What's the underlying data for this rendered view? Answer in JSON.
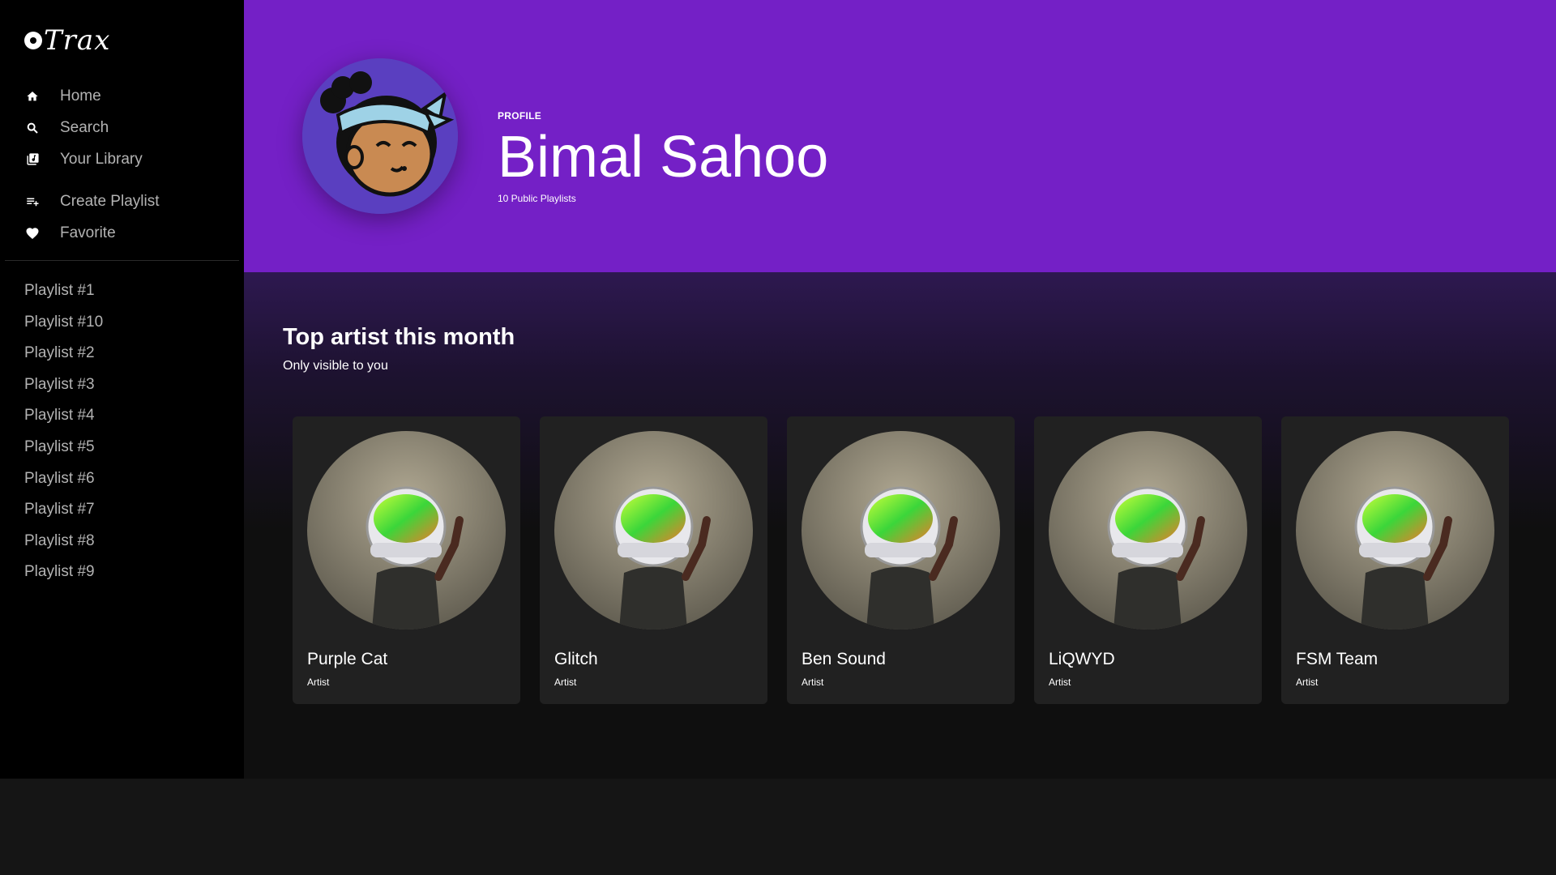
{
  "app": {
    "logo_text": "Trax"
  },
  "nav": {
    "main": [
      {
        "label": "Home",
        "icon": "home-icon"
      },
      {
        "label": "Search",
        "icon": "search-icon"
      },
      {
        "label": "Your Library",
        "icon": "library-icon"
      }
    ],
    "actions": [
      {
        "label": "Create Playlist",
        "icon": "playlist-add-icon"
      },
      {
        "label": "Favorite",
        "icon": "heart-icon"
      }
    ]
  },
  "playlists": [
    "Playlist #1",
    "Playlist #10",
    "Playlist #2",
    "Playlist #3",
    "Playlist #4",
    "Playlist #5",
    "Playlist #6",
    "Playlist #7",
    "Playlist #8",
    "Playlist #9"
  ],
  "profile": {
    "kind": "PROFILE",
    "name": "Bimal Sahoo",
    "public_playlists": "10 Public Playlists",
    "header_color": "#7420c6"
  },
  "section": {
    "title": "Top artist this month",
    "subtitle": "Only visible to you"
  },
  "artists": [
    {
      "name": "Purple Cat",
      "type": "Artist"
    },
    {
      "name": "Glitch",
      "type": "Artist"
    },
    {
      "name": "Ben Sound",
      "type": "Artist"
    },
    {
      "name": "LiQWYD",
      "type": "Artist"
    },
    {
      "name": "FSM Team",
      "type": "Artist"
    }
  ]
}
